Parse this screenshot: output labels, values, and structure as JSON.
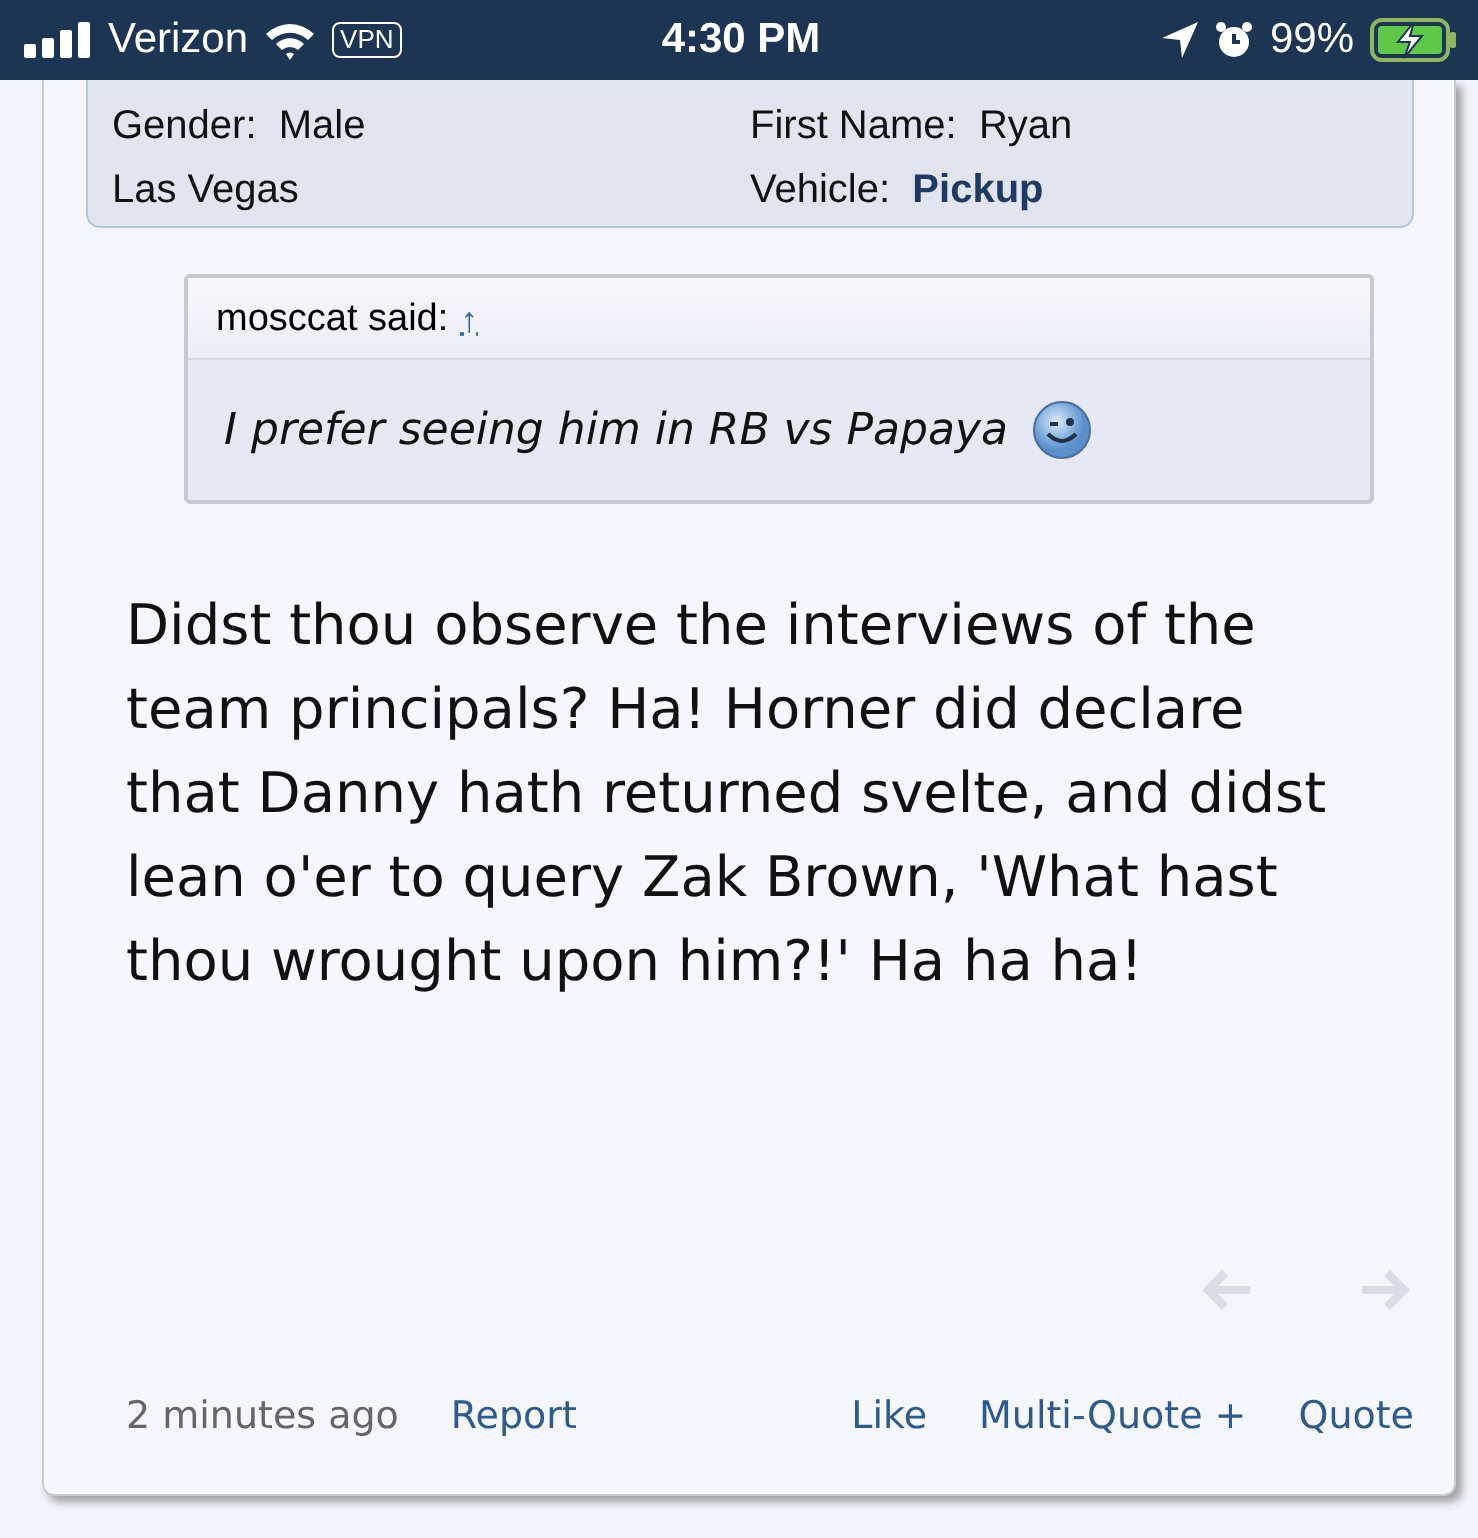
{
  "status_bar": {
    "carrier": "Verizon",
    "vpn": "VPN",
    "time": "4:30 PM",
    "battery": "99%"
  },
  "profile": {
    "fields": [
      {
        "label": "Gender:",
        "value": "Male",
        "kind": "plain"
      },
      {
        "label": "First Name:",
        "value": "Ryan",
        "kind": "plain"
      },
      {
        "value": "Las Vegas",
        "kind": "plain"
      },
      {
        "label": "Vehicle:",
        "value": "Pickup",
        "kind": "bold"
      }
    ]
  },
  "quote": {
    "author": "mosccat said:",
    "link": "↑",
    "text": "I prefer seeing him in RB vs Papaya"
  },
  "message": "Didst thou observe the interviews of the team principals? Ha! Horner did declare that Danny hath returned svelte, and didst lean o'er to query Zak Brown, 'What hast thou wrought upon him?!' Ha ha ha!",
  "nav": [
    {
      "kind": "prev",
      "disabled": true
    },
    {
      "kind": "next",
      "disabled": true
    }
  ],
  "footer": {
    "time": "2 minutes ago",
    "actions": [
      "Report",
      "Like",
      "Multi-Quote +",
      "Quote"
    ]
  }
}
